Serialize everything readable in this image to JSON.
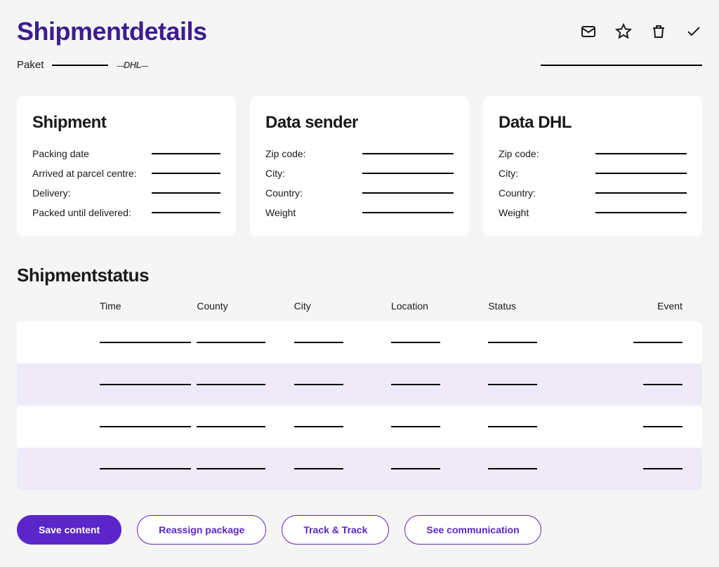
{
  "header": {
    "title": "Shipmentdetails"
  },
  "meta": {
    "packet_label": "Paket",
    "carrier_logo_text": "DHL"
  },
  "cards": {
    "shipment": {
      "title": "Shipment",
      "fields": {
        "packing_date": "Packing date",
        "arrived": "Arrived at parcel centre:",
        "delivery": "Delivery:",
        "packed_until": "Packed until delivered:"
      }
    },
    "sender": {
      "title": "Data sender",
      "fields": {
        "zip": "Zip code:",
        "city": "City:",
        "country": "Country:",
        "weight": "Weight"
      }
    },
    "dhl": {
      "title": "Data DHL",
      "fields": {
        "zip": "Zip code:",
        "city": "City:",
        "country": "Country:",
        "weight": "Weight"
      }
    }
  },
  "status": {
    "title": "Shipmentstatus",
    "columns": {
      "time": "Time",
      "county": "County",
      "city": "City",
      "location": "Location",
      "status": "Status",
      "event": "Event"
    }
  },
  "buttons": {
    "save": "Save content",
    "reassign": "Reassign package",
    "track": "Track & Track",
    "communication": "See communication"
  }
}
